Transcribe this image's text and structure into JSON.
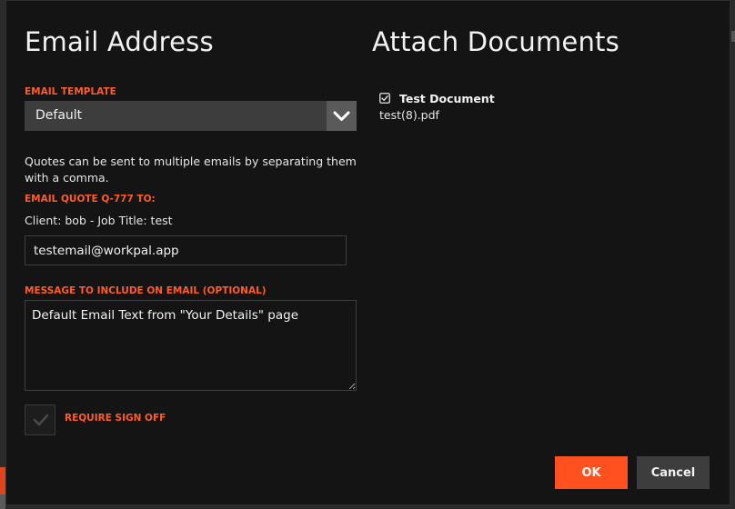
{
  "left": {
    "title": "Email Address",
    "template_label": "EMAIL TEMPLATE",
    "template_value": "Default",
    "help_text": "Quotes can be sent to multiple emails by separating them with a comma.",
    "email_to_label": "EMAIL QUOTE Q-777 TO:",
    "client_line": "Client: bob - Job Title: test",
    "email_value": "testemail@workpal.app",
    "message_label": "MESSAGE TO INCLUDE ON EMAIL (OPTIONAL)",
    "message_value": "Default Email Text from \"Your Details\" page",
    "signoff_label": "REQUIRE SIGN OFF"
  },
  "right": {
    "title": "Attach Documents",
    "document": {
      "name": "Test Document",
      "file": "test(8).pdf",
      "checked": true
    }
  },
  "actions": {
    "ok_label": "OK",
    "cancel_label": "Cancel"
  },
  "colors": {
    "accent": "#ff5020",
    "label": "#ff5c2a",
    "dialog_bg": "#141414",
    "control_bg": "#3d3d3d"
  },
  "icons": {
    "dropdown": "chevron-down-icon",
    "signoff": "check-icon",
    "document": "checkbox-checked-icon"
  }
}
